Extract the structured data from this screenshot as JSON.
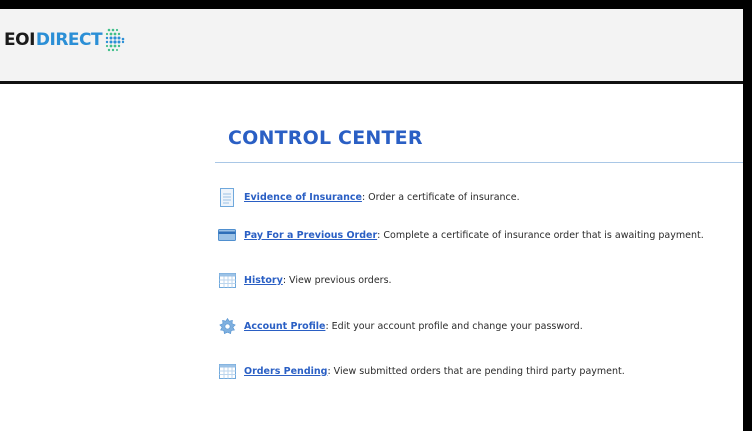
{
  "brand": {
    "logo_left": "EOI",
    "logo_right": "DIRECT"
  },
  "page": {
    "title": "CONTROL CENTER"
  },
  "menu": [
    {
      "icon": "document-icon",
      "link": "Evidence of Insurance",
      "desc": ": Order a certificate of insurance."
    },
    {
      "icon": "credit-card-icon",
      "link": "Pay For a Previous Order",
      "desc": ": Complete a certificate of insurance order that is awaiting payment."
    },
    {
      "icon": "calendar-icon",
      "link": "History",
      "desc": ": View previous orders."
    },
    {
      "icon": "gear-icon",
      "link": "Account Profile",
      "desc": ": Edit your account profile and change your password."
    },
    {
      "icon": "calendar-icon",
      "link": "Orders Pending",
      "desc": ": View submitted orders that are pending third party payment."
    }
  ],
  "colors": {
    "accent": "#2a5fc4",
    "logo_blue": "#2b8fd6",
    "logo_green": "#3fbf8a",
    "rule": "#a9c7e6",
    "icon_blue": "#6fa8dc"
  }
}
